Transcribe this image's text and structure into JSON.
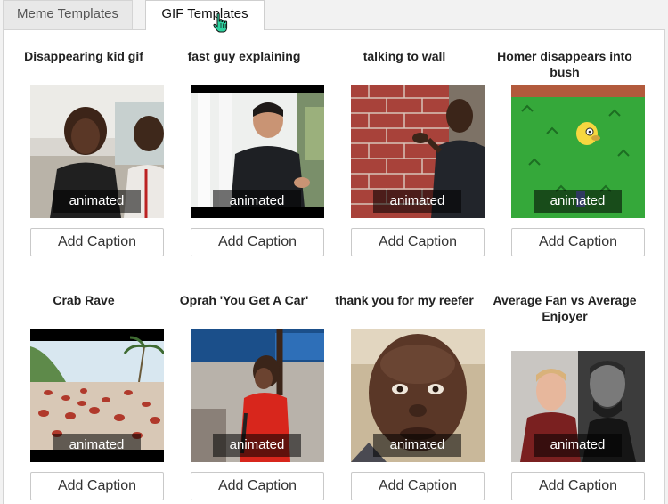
{
  "tabs": {
    "meme_label": "Meme Templates",
    "gif_label": "GIF Templates"
  },
  "templates": [
    {
      "title": "Disappearing kid gif",
      "badge": "animated",
      "button": "Add Caption"
    },
    {
      "title": "fast guy explaining",
      "badge": "animated",
      "button": "Add Caption"
    },
    {
      "title": "talking to wall",
      "badge": "animated",
      "button": "Add Caption"
    },
    {
      "title": "Homer disappears into bush",
      "badge": "animated",
      "button": "Add Caption"
    },
    {
      "title": "Crab Rave",
      "badge": "animated",
      "button": "Add Caption"
    },
    {
      "title": "Oprah 'You Get A Car'",
      "badge": "animated",
      "button": "Add Caption"
    },
    {
      "title": "thank you for my reefer",
      "badge": "animated",
      "button": "Add Caption"
    },
    {
      "title": "Average Fan vs Average Enjoyer",
      "badge": "animated",
      "button": "Add Caption"
    }
  ],
  "colors": {
    "active_tab_bg": "#ffffff",
    "inactive_tab_bg": "#e8e8e8",
    "badge_bg": "rgba(0,0,0,0.55)"
  }
}
